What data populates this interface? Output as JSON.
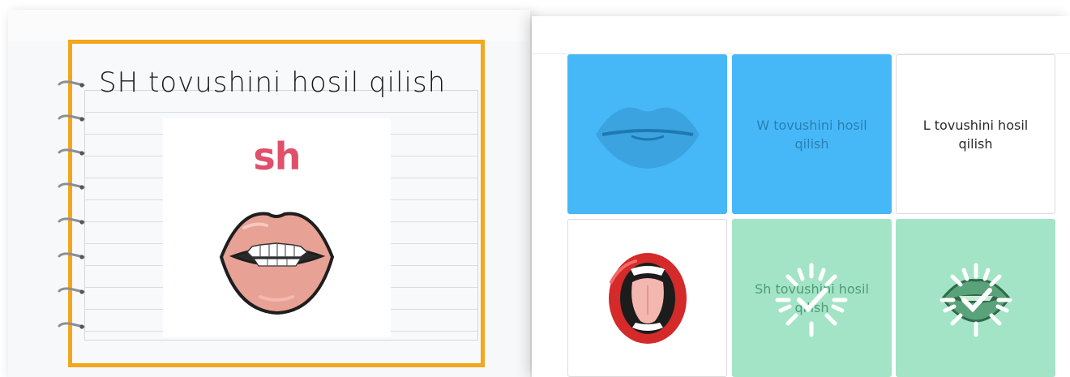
{
  "notebook": {
    "title": "SH tovushini hosil qilish",
    "image_caption": "sh",
    "frame_color": "#f4a61d",
    "ring_count": 8
  },
  "board": {
    "tiles": [
      {
        "type": "image",
        "image": "closed-blue-lips-icon",
        "state": "selected",
        "color": "#46b8f8"
      },
      {
        "type": "text",
        "text": "W tovushini hosil qilish",
        "state": "selected",
        "color": "#46b8f8"
      },
      {
        "type": "text",
        "text": "L tovushini hosil qilish",
        "state": "default"
      },
      {
        "type": "image",
        "image": "open-mouth-tongue-icon",
        "state": "default"
      },
      {
        "type": "text",
        "text": "Sh tovushini hosil qilish",
        "state": "matched",
        "color": "#a3e4c6",
        "badge": "checkmark-burst-icon"
      },
      {
        "type": "image",
        "image": "teeth-lips-icon",
        "state": "matched",
        "color": "#a3e4c6",
        "badge": "checkmark-burst-icon"
      }
    ]
  }
}
